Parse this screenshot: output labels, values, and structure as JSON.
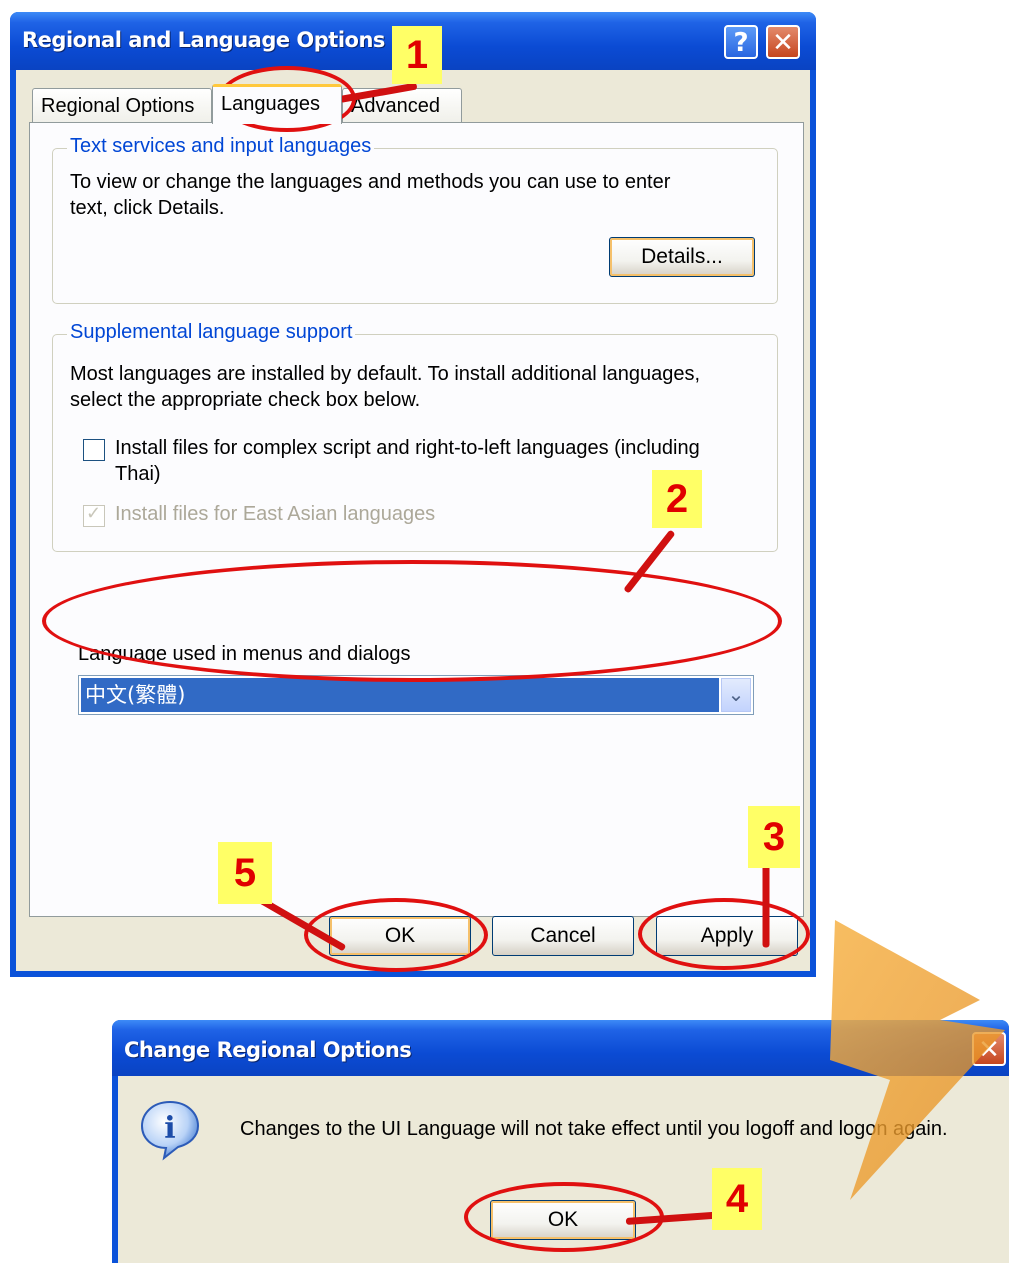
{
  "main_dialog": {
    "title": "Regional and Language Options",
    "help_label": "?",
    "close_label": "✕",
    "tabs": [
      {
        "label": "Regional Options"
      },
      {
        "label": "Languages"
      },
      {
        "label": "Advanced"
      }
    ],
    "text_services": {
      "legend": "Text services and input languages",
      "description_line1": "To view or change the languages and methods you can use to enter",
      "description_line2": "text, click Details.",
      "details_button": "Details..."
    },
    "supplemental": {
      "legend": "Supplemental language support",
      "description_line1": "Most languages are installed by default. To install additional languages,",
      "description_line2": "select the appropriate check box below.",
      "complex_script_line1": "Install files for complex script and right-to-left languages (including",
      "complex_script_line2": "Thai)",
      "complex_script_checked": false,
      "east_asian": "Install files for East Asian languages",
      "east_asian_checked": true
    },
    "ui_language": {
      "label": "Language used in menus and dialogs",
      "selected": "中文(繁體)"
    },
    "buttons": {
      "ok": "OK",
      "cancel": "Cancel",
      "apply": "Apply"
    }
  },
  "change_dialog": {
    "title": "Change Regional Options",
    "close_label": "✕",
    "info_icon_glyph": "i",
    "message": "Changes to the UI Language will not take effect until you logoff and logon again.",
    "ok": "OK"
  },
  "annotations": {
    "steps": [
      "1",
      "2",
      "3",
      "4",
      "5"
    ],
    "color": "#e01010",
    "badge_color": "#ffff66"
  },
  "colors": {
    "titlebar": "#0b4bd4",
    "dialog_face": "#ece9d8",
    "legend_text": "#0046d5",
    "selection": "#316ac5"
  }
}
